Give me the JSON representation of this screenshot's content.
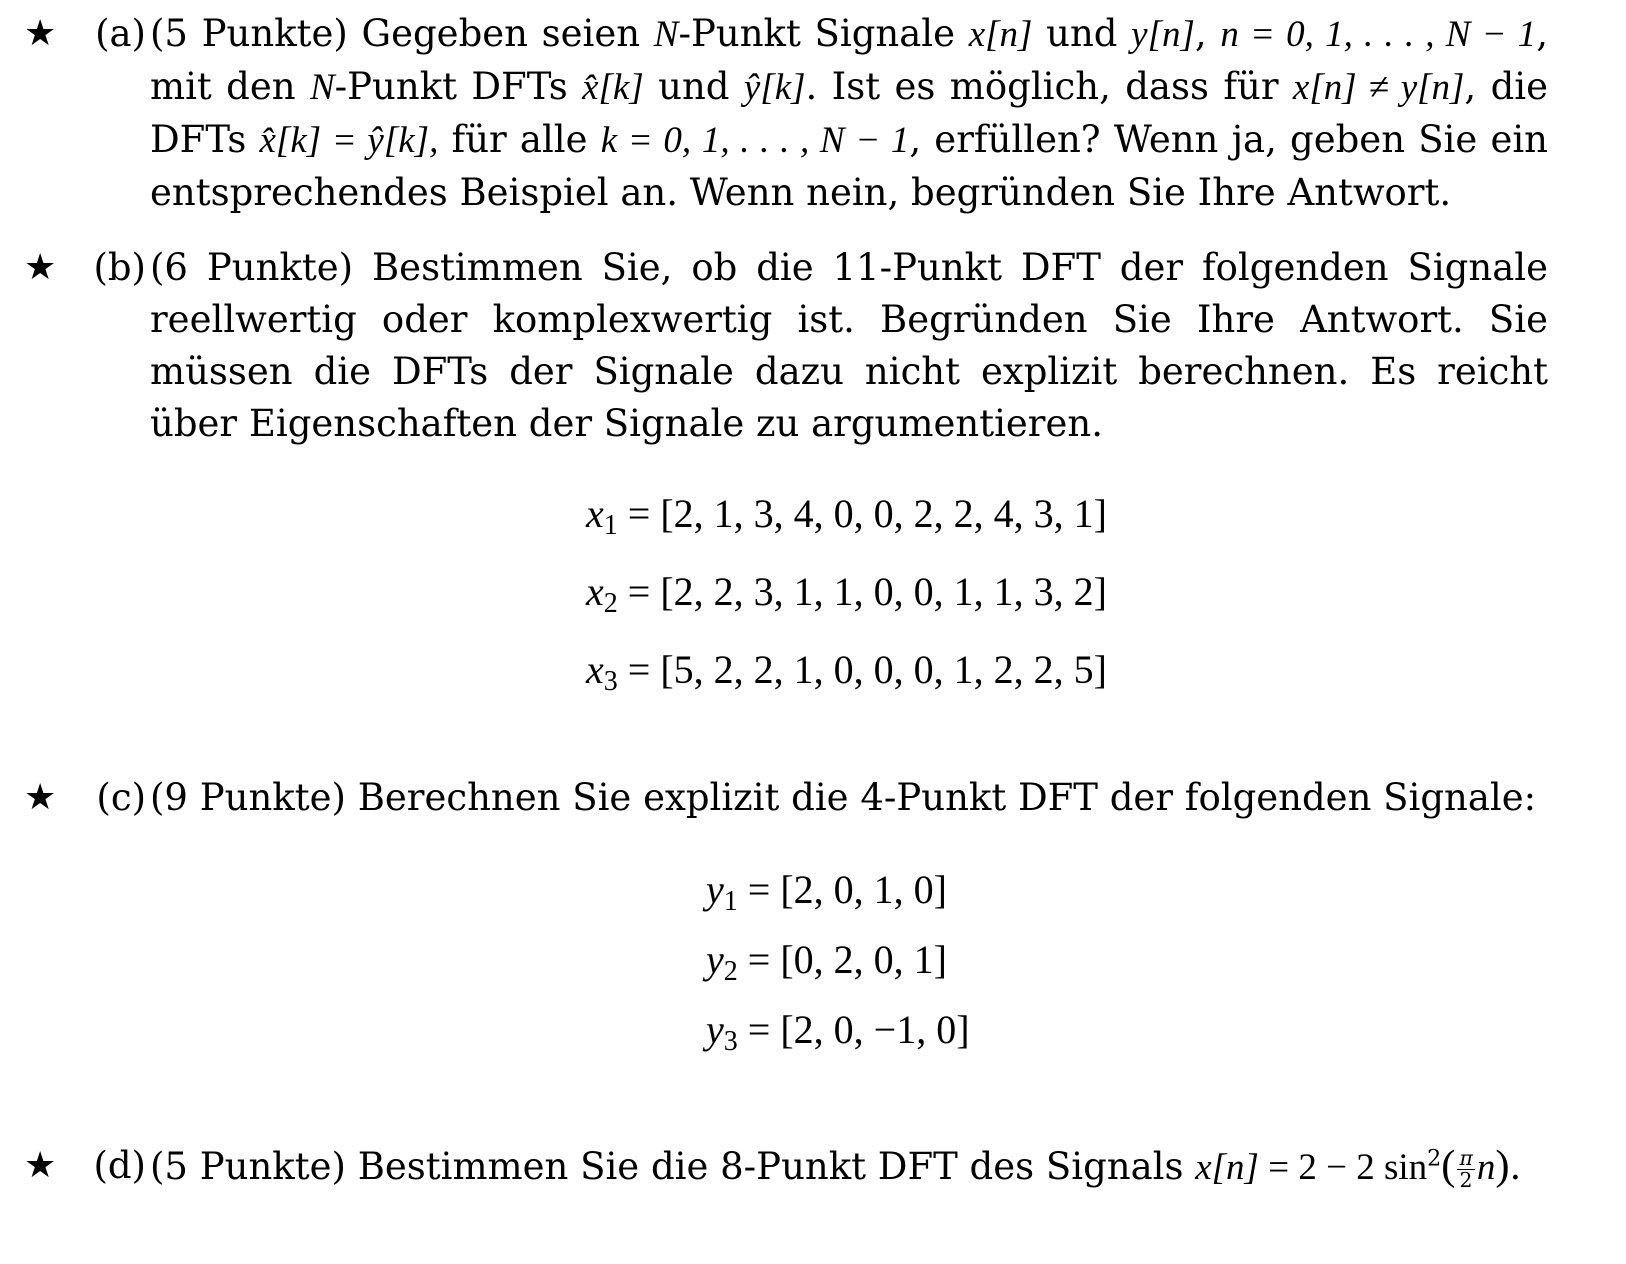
{
  "star_glyph": "★",
  "problems": [
    {
      "label": "(a)",
      "points": "(5 Punkte)",
      "text_parts": [
        "Gegeben seien ",
        "N",
        "-Punkt Signale ",
        "x[n]",
        " und ",
        "y[n]",
        ", ",
        "n = 0, 1, . . . , N − 1",
        ", mit den ",
        "N",
        "-Punkt DFTs ",
        "x̂[k]",
        " und ",
        "ŷ[k]",
        ". Ist es möglich, dass für ",
        "x[n] ≠ y[n]",
        ", die DFTs ",
        "x̂[k] = ŷ[k],",
        " für alle ",
        "k = 0, 1, . . . , N − 1",
        ", erfüllen? Wenn ja, geben Sie ein entsprechendes Beispiel an. Wenn nein, begründen Sie Ihre Antwort."
      ]
    },
    {
      "label": "(b)",
      "points": "(6 Punkte)",
      "text": "Bestimmen Sie, ob die 11-Punkt DFT der folgenden Signale reellwertig oder komplexwertig ist. Begründen Sie Ihre Antwort. Sie müssen die DFTs der Signale dazu nicht explizit berechnen. Es reicht über Eigenschaften der Signale zu argumentieren.",
      "equations": [
        {
          "var": "x",
          "sub": "1",
          "rhs": "= [2, 1, 3, 4, 0, 0, 2, 2, 4, 3, 1]"
        },
        {
          "var": "x",
          "sub": "2",
          "rhs": "= [2, 2, 3, 1, 1, 0, 0, 1, 1, 3, 2]"
        },
        {
          "var": "x",
          "sub": "3",
          "rhs": "= [5, 2, 2, 1, 0, 0, 0, 1, 2, 2, 5]"
        }
      ]
    },
    {
      "label": "(c)",
      "points": "(9 Punkte)",
      "text": "Berechnen Sie explizit die 4-Punkt DFT der folgenden Signale:",
      "equations": [
        {
          "var": "y",
          "sub": "1",
          "rhs": "= [2, 0, 1, 0]"
        },
        {
          "var": "y",
          "sub": "2",
          "rhs": "= [0, 2, 0, 1]"
        },
        {
          "var": "y",
          "sub": "3",
          "rhs": "= [2, 0, −1, 0]"
        }
      ]
    },
    {
      "label": "(d)",
      "points": "(5 Punkte)",
      "text": "Bestimmen Sie die 8-Punkt DFT des Signals ",
      "formula": {
        "lhs": "x[n]",
        "mid": " = 2 − 2 sin",
        "exp": "2",
        "frac_num": "π",
        "frac_den": "2",
        "var": "n",
        "end": "."
      }
    }
  ]
}
